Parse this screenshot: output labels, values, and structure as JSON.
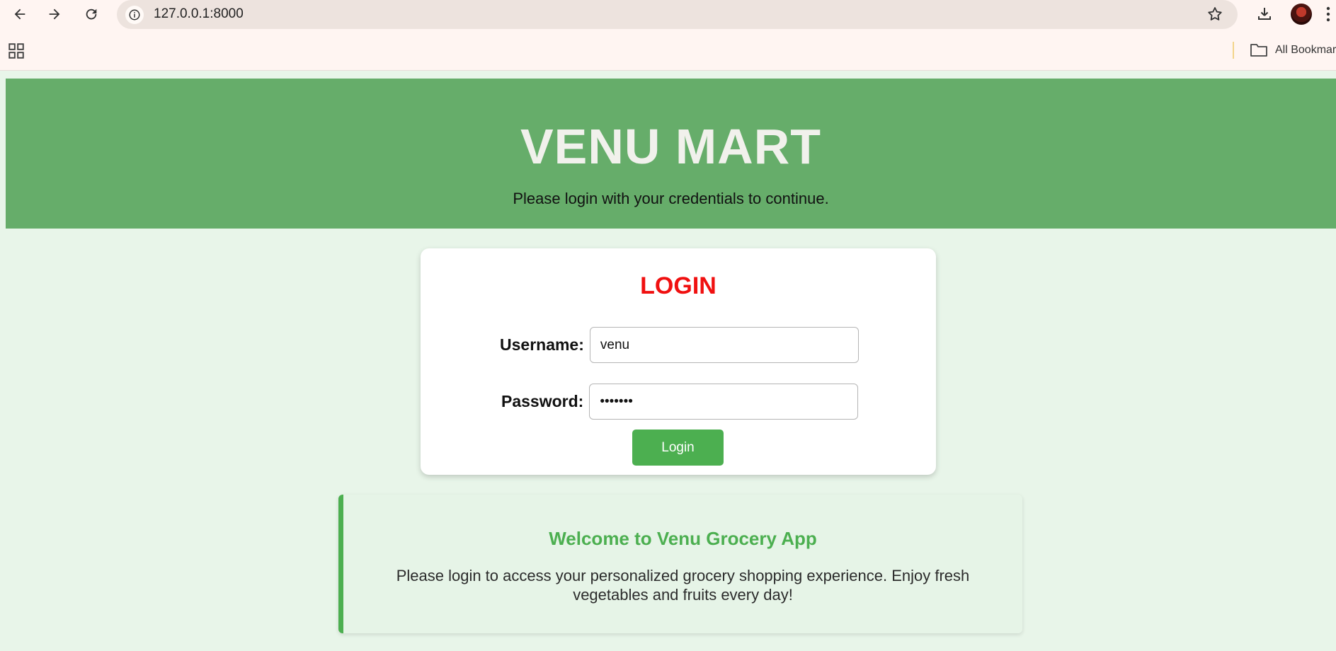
{
  "browser": {
    "url": "127.0.0.1:8000",
    "bookmarks_folder": "All Bookmarks",
    "icons": {
      "back": "back-arrow-icon",
      "forward": "forward-arrow-icon",
      "reload": "reload-icon",
      "info": "site-info-icon",
      "bookmark": "star-icon",
      "download": "download-icon",
      "apps": "apps-grid-icon",
      "folder": "folder-icon"
    }
  },
  "hero": {
    "title": "VENU MART",
    "subtitle": "Please login with your credentials to continue."
  },
  "login": {
    "title": "LOGIN",
    "username_label": "Username:",
    "username_value": "venu",
    "password_label": "Password:",
    "password_value": "•••••••",
    "button_label": "Login"
  },
  "welcome": {
    "title": "Welcome to Venu Grocery App",
    "text": "Please login to access your personalized grocery shopping experience. Enjoy fresh vegetables and fruits every day!"
  },
  "colors": {
    "hero_bg": "#66ad6a",
    "page_bg": "#e8f5e9",
    "login_title": "#f01010",
    "accent_green": "#4caf50"
  }
}
